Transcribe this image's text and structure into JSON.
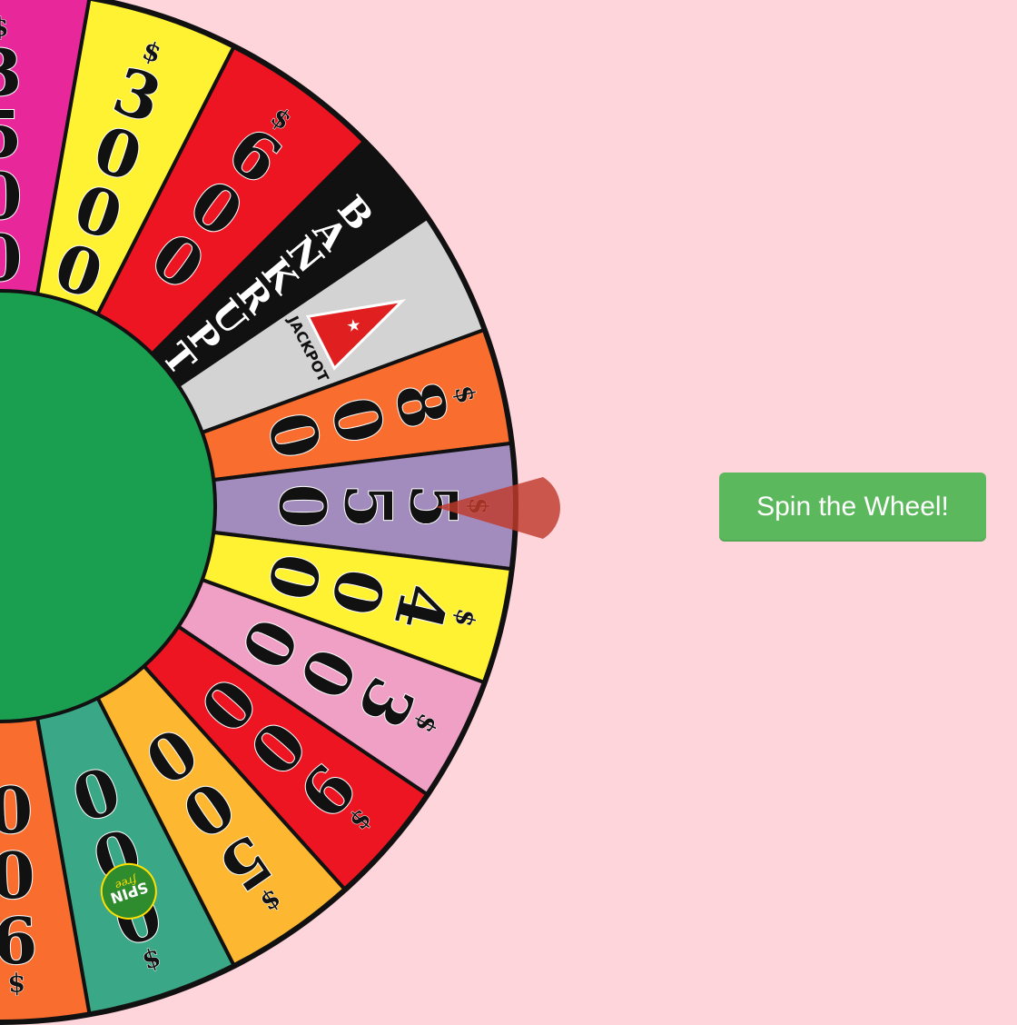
{
  "spin_button": {
    "label": "Spin the Wheel!"
  },
  "wheel": {
    "hub_color": "#1a9e4f",
    "pointer_color": "#c0392b",
    "segments": [
      {
        "type": "money",
        "value": "3500",
        "color": "#e8279b",
        "text_color": "#111111"
      },
      {
        "type": "money",
        "value": "3000",
        "color": "#fff233",
        "text_color": "#111111"
      },
      {
        "type": "money",
        "value": "600",
        "color": "#ee1522",
        "text_color": "#111111"
      },
      {
        "type": "word",
        "value": "BANKRUPT",
        "color": "#111111",
        "text_color": "#ffffff"
      },
      {
        "type": "jackpot",
        "value": "JACKPOT",
        "color": "#d3d3d3",
        "text_color": "#111111"
      },
      {
        "type": "money",
        "value": "800",
        "color": "#f96d2f",
        "text_color": "#111111"
      },
      {
        "type": "money",
        "value": "550",
        "color": "#a28bbd",
        "text_color": "#111111"
      },
      {
        "type": "money",
        "value": "400",
        "color": "#fff233",
        "text_color": "#111111"
      },
      {
        "type": "money",
        "value": "300",
        "color": "#f0a0c5",
        "text_color": "#111111"
      },
      {
        "type": "money",
        "value": "900",
        "color": "#ee1522",
        "text_color": "#111111"
      },
      {
        "type": "money",
        "value": "500",
        "color": "#fdb731",
        "text_color": "#111111"
      },
      {
        "type": "freespin",
        "value": "000",
        "badge": "SPIN",
        "badge_script": "free",
        "color": "#3aa886",
        "text_color": "#111111"
      },
      {
        "type": "money",
        "value": "900",
        "color": "#f96d2f",
        "text_color": "#111111"
      }
    ]
  }
}
